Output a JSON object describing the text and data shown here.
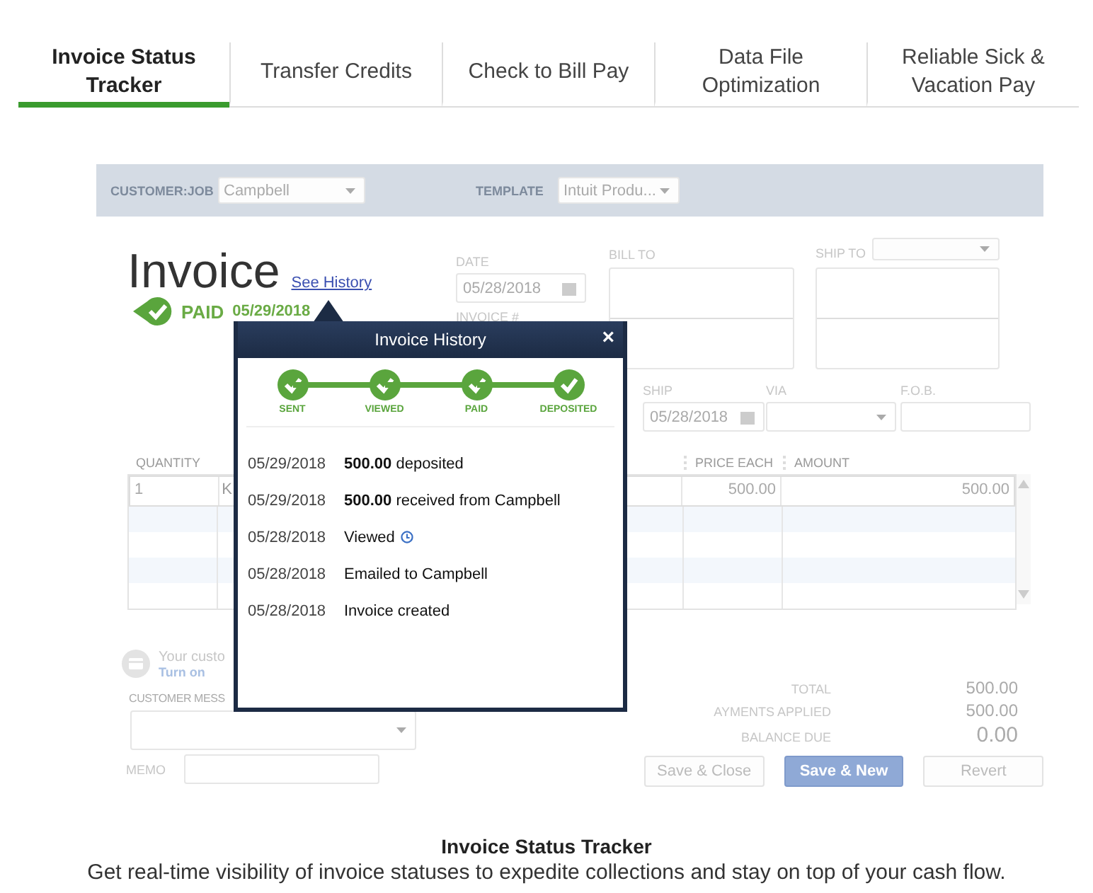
{
  "tabs": [
    {
      "label": "Invoice Status Tracker",
      "selected": true
    },
    {
      "label": "Transfer Credits",
      "selected": false
    },
    {
      "label": "Check to Bill Pay",
      "selected": false
    },
    {
      "label": "Data File Optimization",
      "selected": false
    },
    {
      "label": "Reliable Sick & Vacation Pay",
      "selected": false
    }
  ],
  "form": {
    "header_fields": [
      {
        "label": "CUSTOMER:JOB",
        "value": "Campbell"
      },
      {
        "label": "TEMPLATE",
        "value": "Intuit Produ..."
      }
    ],
    "title": "Invoice",
    "history_link": "See History",
    "status": {
      "label": "PAID",
      "date": "05/29/2018",
      "paid": true
    },
    "date_field": {
      "label": "DATE",
      "value": "05/28/2018"
    },
    "invoice_number_label": "INVOICE #",
    "bill_to_label": "BILL TO",
    "ship_to_label": "SHIP TO",
    "ship_field": {
      "label": "SHIP",
      "value": "05/28/2018"
    },
    "via_label": "VIA",
    "fob_label": "F.O.B.",
    "table": {
      "columns": [
        "QUANTITY",
        "PRICE EACH",
        "AMOUNT"
      ],
      "rows": [
        {
          "quantity": "1",
          "item": "K",
          "price": "500.00",
          "amount": "500.00"
        }
      ]
    },
    "payment_note": {
      "text": "Your custo",
      "link": "Turn on"
    },
    "customer_message_label": "CUSTOMER MESS",
    "memo_label": "MEMO",
    "totals": [
      {
        "label": "TOTAL",
        "value": "500.00",
        "emphasis": false
      },
      {
        "label": "AYMENTS APPLIED",
        "value": "500.00",
        "emphasis": false
      },
      {
        "label": "BALANCE DUE",
        "value": "0.00",
        "emphasis": true
      }
    ],
    "buttons": [
      {
        "label": "Save & Close",
        "primary": false
      },
      {
        "label": "Save & New",
        "primary": true
      },
      {
        "label": "Revert",
        "primary": false
      }
    ]
  },
  "history": {
    "title": "Invoice History",
    "close": "×",
    "steps": [
      {
        "label": "SENT",
        "done": true
      },
      {
        "label": "VIEWED",
        "done": true
      },
      {
        "label": "PAID",
        "done": true
      },
      {
        "label": "DEPOSITED",
        "done": true
      }
    ],
    "events": [
      {
        "date": "05/29/2018",
        "text": "**500.00** deposited",
        "info": false
      },
      {
        "date": "05/29/2018",
        "text": "**500.00** received from Campbell",
        "info": false
      },
      {
        "date": "05/28/2018",
        "text": "Viewed",
        "info": true
      },
      {
        "date": "05/28/2018",
        "text": "Emailed to Campbell",
        "info": false
      },
      {
        "date": "05/28/2018",
        "text": "Invoice created",
        "info": false
      }
    ]
  },
  "caption": {
    "title": "Invoice Status Tracker",
    "text": "Get real-time visibility of invoice statuses to expedite collections and stay on top of your cash flow."
  }
}
